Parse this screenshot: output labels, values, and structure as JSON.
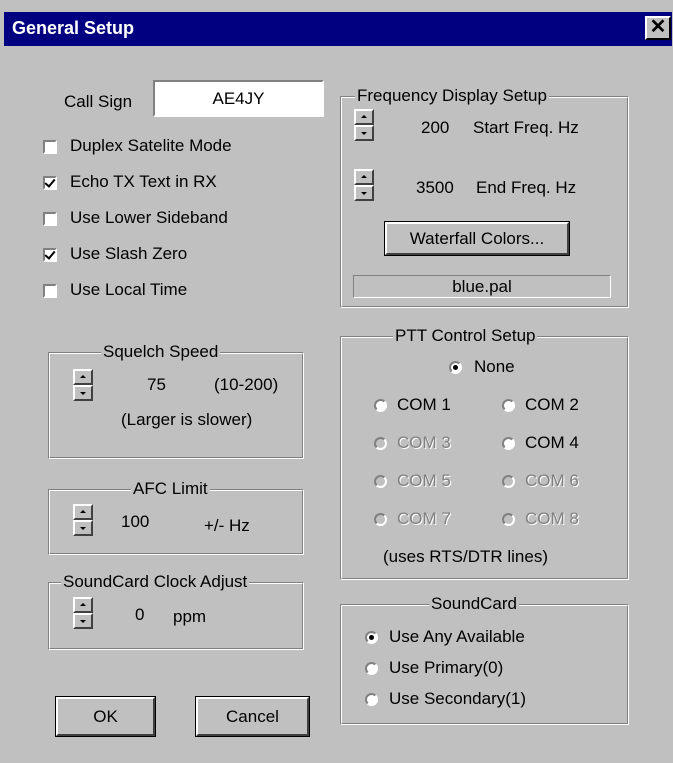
{
  "window": {
    "title": "General Setup",
    "close_label": "✕"
  },
  "callsign": {
    "label": "Call Sign",
    "value": "AE4JY"
  },
  "options": [
    {
      "label": "Duplex Satelite Mode",
      "checked": false
    },
    {
      "label": "Echo TX Text in RX",
      "checked": true
    },
    {
      "label": "Use Lower Sideband",
      "checked": false
    },
    {
      "label": "Use Slash Zero",
      "checked": true
    },
    {
      "label": "Use Local Time",
      "checked": false
    }
  ],
  "squelch": {
    "title": "Squelch Speed",
    "value": "75",
    "range": "(10-200)",
    "note": "(Larger is slower)"
  },
  "afc": {
    "title": "AFC Limit",
    "value": "100",
    "unit": "+/- Hz"
  },
  "clock": {
    "title": "SoundCard Clock Adjust",
    "value": "0",
    "unit": "ppm"
  },
  "freq": {
    "title": "Frequency Display Setup",
    "start_value": "200",
    "start_label": "Start Freq. Hz",
    "end_value": "3500",
    "end_label": "End Freq. Hz",
    "waterfall_button": "Waterfall Colors...",
    "palette": "blue.pal"
  },
  "ptt": {
    "title": "PTT Control Setup",
    "none": "None",
    "ports": [
      "COM 1",
      "COM 2",
      "COM 3",
      "COM 4",
      "COM 5",
      "COM 6",
      "COM 7",
      "COM 8"
    ],
    "note": "(uses  RTS/DTR lines)"
  },
  "soundcard": {
    "title": "SoundCard",
    "options": [
      "Use Any Available",
      "Use Primary(0)",
      "Use Secondary(1)"
    ]
  },
  "buttons": {
    "ok": "OK",
    "cancel": "Cancel"
  }
}
